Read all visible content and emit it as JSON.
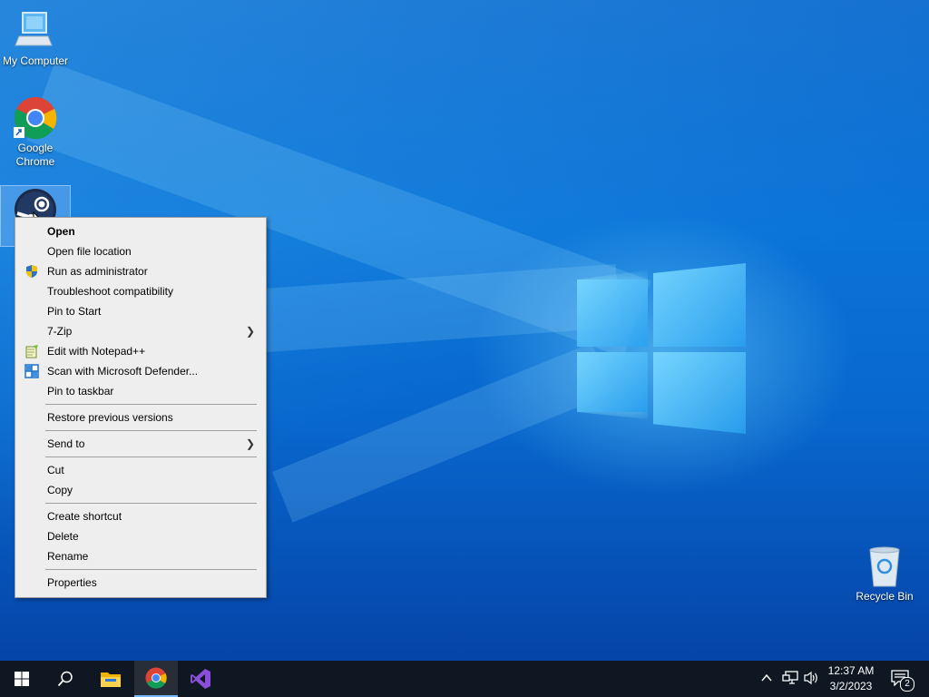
{
  "desktop": {
    "icons": [
      {
        "label": "My Computer",
        "icon": "computer-icon"
      },
      {
        "label": "Google",
        "label2": "Chrome",
        "icon": "chrome-icon"
      },
      {
        "label": "Steam",
        "icon": "steam-icon"
      },
      {
        "label": "Recycle Bin",
        "icon": "recycle-bin-icon"
      }
    ]
  },
  "context_menu": {
    "items": [
      {
        "label": "Open",
        "bold": true
      },
      {
        "label": "Open file location"
      },
      {
        "label": "Run as administrator",
        "icon": "uac-shield-icon"
      },
      {
        "label": "Troubleshoot compatibility"
      },
      {
        "label": "Pin to Start"
      },
      {
        "label": "7-Zip",
        "submenu": true
      },
      {
        "label": "Edit with Notepad++",
        "icon": "notepad-plus-plus-icon"
      },
      {
        "label": "Scan with Microsoft Defender...",
        "icon": "defender-icon"
      },
      {
        "label": "Pin to taskbar"
      },
      {
        "label": "Restore previous versions"
      },
      {
        "label": "Send to",
        "submenu": true
      },
      {
        "label": "Cut"
      },
      {
        "label": "Copy"
      },
      {
        "label": "Create shortcut"
      },
      {
        "label": "Delete"
      },
      {
        "label": "Rename"
      },
      {
        "label": "Properties"
      }
    ]
  },
  "taskbar": {
    "apps": [
      "start-icon",
      "search-icon",
      "file-explorer-icon",
      "chrome-icon",
      "visual-studio-icon"
    ],
    "clock_time": "12:37 AM",
    "clock_date": "3/2/2023",
    "notification_count": "2",
    "tray_icons": [
      "chevron-up-icon",
      "network-icon",
      "volume-icon"
    ]
  },
  "colors": {
    "taskbar": "#0f1722",
    "desktop": "#0a74d8",
    "menu_bg": "#eeeeee",
    "accent": "#3aa0ff"
  }
}
